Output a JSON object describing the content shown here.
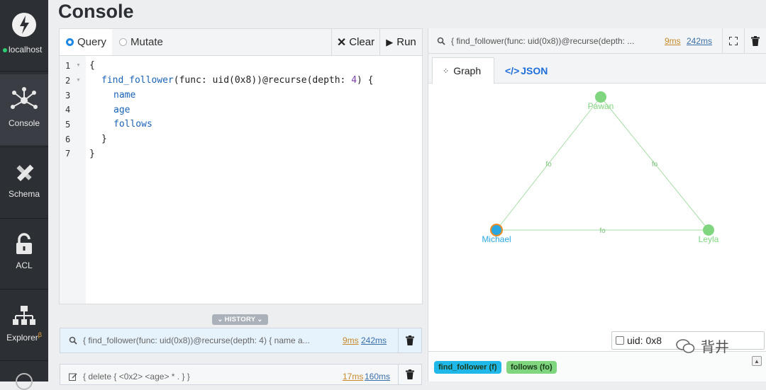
{
  "sidebar": {
    "server": {
      "label": "localhost",
      "status_color": "#2ecc71"
    },
    "items": [
      {
        "label": "Console",
        "icon": "graph-nodes-icon",
        "active": true
      },
      {
        "label": "Schema",
        "icon": "pencil-ruler-icon"
      },
      {
        "label": "ACL",
        "icon": "lock-icon"
      },
      {
        "label": "Explorer",
        "superscript": "β",
        "icon": "hierarchy-icon"
      }
    ]
  },
  "page": {
    "title": "Console"
  },
  "editor": {
    "modes": [
      {
        "label": "Query",
        "selected": true
      },
      {
        "label": "Mutate",
        "selected": false
      }
    ],
    "clear_label": "Clear",
    "run_label": "Run",
    "line_numbers": [
      "1",
      "2",
      "3",
      "4",
      "5",
      "6",
      "7"
    ],
    "code": {
      "l1": "{",
      "l2_fn": "find_follower",
      "l2_mid": "(func: uid(0x8))@recurse(depth: ",
      "l2_num": "4",
      "l2_end": ") {",
      "l3": "name",
      "l4": "age",
      "l5": "follows",
      "l6": "}",
      "l7": "}"
    }
  },
  "history": {
    "toggle_label": "HISTORY",
    "items": [
      {
        "query": "{ find_follower(func: uid(0x8))@recurse(depth: 4) { name a...",
        "server_time": "9ms",
        "total_time": "242ms",
        "icon": "search-icon"
      },
      {
        "query": "{ delete { <0x2> <age> * . } }",
        "server_time": "17ms",
        "total_time": "160ms",
        "icon": "edit-icon"
      }
    ]
  },
  "result": {
    "query": "{ find_follower(func: uid(0x8))@recurse(depth: ...",
    "server_time": "9ms",
    "total_time": "242ms",
    "tabs": [
      {
        "label": "Graph",
        "active": true
      },
      {
        "label": "JSON",
        "active": false
      }
    ],
    "graph": {
      "nodes": [
        {
          "id": "pawan",
          "label": "Pawan",
          "color": "#7fd67f"
        },
        {
          "id": "michael",
          "label": "Michael",
          "color": "#29a8e0",
          "selected": true
        },
        {
          "id": "leyla",
          "label": "Leyla",
          "color": "#7fd67f"
        }
      ],
      "edges": [
        {
          "from": "michael",
          "to": "pawan",
          "label": "fo"
        },
        {
          "from": "pawan",
          "to": "leyla",
          "label": "fo"
        },
        {
          "from": "michael",
          "to": "leyla",
          "label": "fo"
        }
      ]
    },
    "selection": {
      "label": "uid: 0x8"
    },
    "legend": [
      {
        "label": "find_follower (f)",
        "color": "#1fb8e8"
      },
      {
        "label": "follows (fo)",
        "color": "#7fd67f"
      }
    ]
  },
  "watermark": {
    "text": "背井"
  }
}
